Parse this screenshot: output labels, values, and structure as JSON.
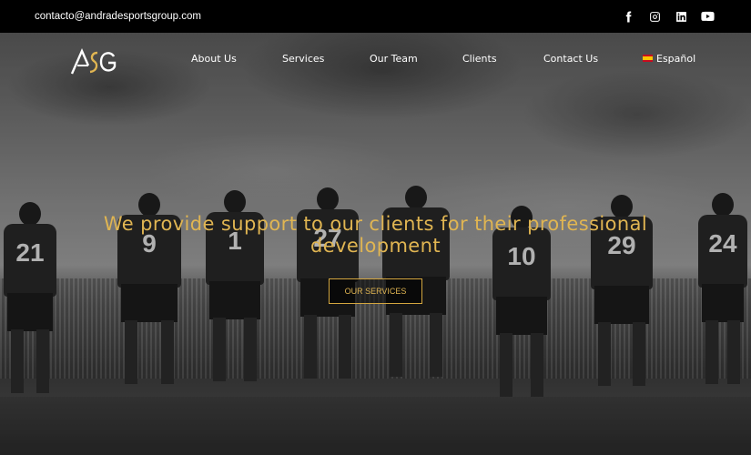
{
  "topbar": {
    "email": "contacto@andradesportsgroup.com",
    "socials": [
      {
        "icon": "facebook-icon"
      },
      {
        "icon": "instagram-icon"
      },
      {
        "icon": "linkedin-icon"
      },
      {
        "icon": "youtube-icon"
      }
    ]
  },
  "nav": {
    "logo_text": "ASG",
    "links": [
      {
        "label": "About Us"
      },
      {
        "label": "Services"
      },
      {
        "label": "Our Team"
      },
      {
        "label": "Clients"
      },
      {
        "label": "Contact Us"
      },
      {
        "label": "Español"
      }
    ]
  },
  "hero": {
    "headline": "We provide support to our clients for their professional development",
    "cta_label": "OUR SERVICES",
    "player_numbers": [
      "21",
      "9",
      "1",
      "27",
      "",
      "10",
      "29",
      "24"
    ]
  },
  "colors": {
    "accent": "#e0b552",
    "topbar_bg": "#000000"
  }
}
